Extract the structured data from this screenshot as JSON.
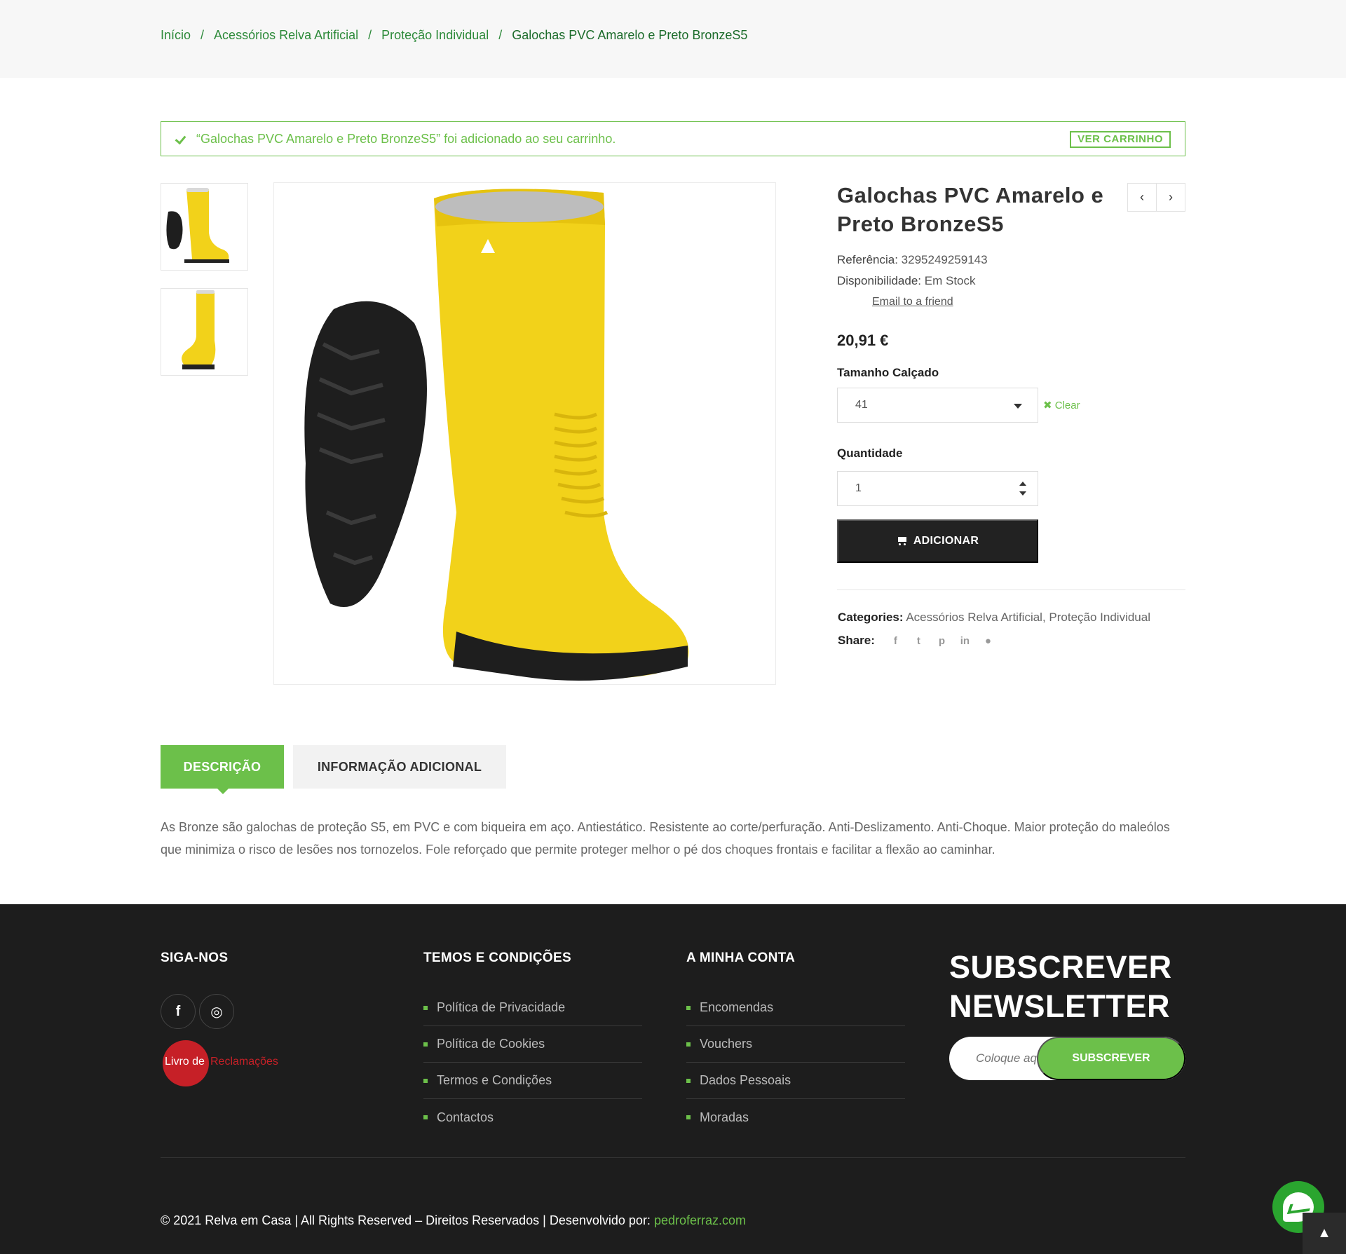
{
  "breadcrumb": {
    "items": [
      "Início",
      "Acessórios Relva Artificial",
      "Proteção Individual"
    ],
    "separator": "/",
    "current": "Galochas PVC Amarelo e Preto BronzeS5"
  },
  "notice": {
    "message": "“Galochas PVC Amarelo e Preto BronzeS5” foi adicionado ao seu carrinho.",
    "view_cart": "VER CARRINHO"
  },
  "product": {
    "title": "Galochas PVC Amarelo e Preto BronzeS5",
    "reference_label": "Referência:",
    "reference": "3295249259143",
    "availability_label": "Disponibilidade:",
    "availability": "Em Stock",
    "email_friend": "Email to a friend",
    "price": "20,91 €",
    "size_label": "Tamanho Calçado",
    "size_value": "41",
    "clear": "Clear",
    "quantity_label": "Quantidade",
    "quantity_value": "1",
    "add_button": "ADICIONAR",
    "categories_label": "Categories:",
    "categories": "Acessórios Relva Artificial, Proteção Individual",
    "share_label": "Share:",
    "share_icons": [
      "facebook-icon",
      "twitter-icon",
      "pinterest-icon",
      "linkedin-icon",
      "reddit-icon"
    ],
    "nav_prev": "‹",
    "nav_next": "›"
  },
  "tabs": [
    {
      "label": "DESCRIÇÃO",
      "active": true
    },
    {
      "label": "INFORMAÇÃO ADICIONAL",
      "active": false
    }
  ],
  "description": "As Bronze são galochas de proteção S5, em PVC e com biqueira em aço. Antiestático. Resistente ao corte/perfuração. Anti-Deslizamento. Anti-Choque. Maior proteção do maleólos que minimiza o risco de lesões nos tornozelos. Fole reforçado que permite proteger melhor o pé dos choques frontais e facilitar a flexão ao caminhar.",
  "footer": {
    "follow_title": "SIGA-NOS",
    "social": {
      "facebook": "f",
      "instagram": "◎"
    },
    "livro_part1": "Livro de",
    "livro_part2": "Reclamações",
    "terms_title": "TEMOS E CONDIÇÕES",
    "terms_links": [
      "Política de Privacidade",
      "Política de Cookies",
      "Termos e Condições",
      "Contactos"
    ],
    "account_title": "A MINHA CONTA",
    "account_links": [
      "Encomendas",
      "Vouchers",
      "Dados Pessoais",
      "Moradas"
    ],
    "newsletter_title_1": "SUBSCREVER",
    "newsletter_title_2": "NEWSLETTER",
    "newsletter_placeholder": "Coloque aqui o seu email",
    "newsletter_button": "SUBSCREVER",
    "copyright": "© 2021 Relva em Casa | All Rights Reserved – Direitos Reservados | Desenvolvido por: ",
    "developer": "pedroferraz.com"
  },
  "colors": {
    "accent": "#6cc04a",
    "breadcrumb": "#2d8a3a",
    "dark": "#222222",
    "footer_bg": "#1d1d1d",
    "boot_yellow": "#f2d21a"
  }
}
